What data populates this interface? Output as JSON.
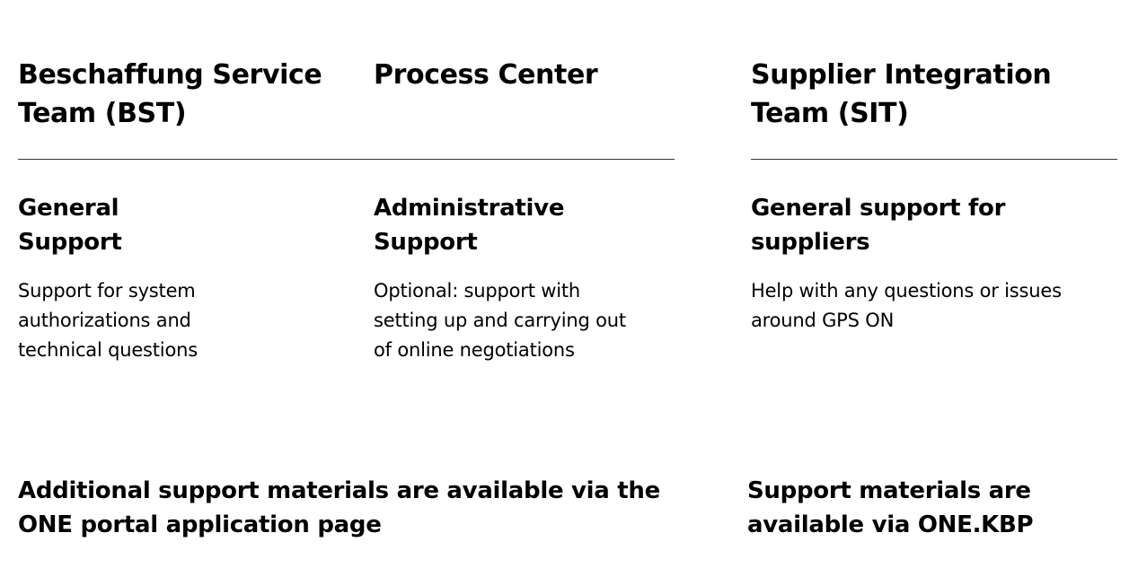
{
  "columns": [
    {
      "team_title": [
        "Beschaffung Service",
        "Team (BST)"
      ],
      "support_title": [
        "General",
        "Support"
      ],
      "support_description": [
        "Support for system",
        "authorizations and",
        "technical questions"
      ]
    },
    {
      "team_title": [
        "Process Center"
      ],
      "support_title": [
        "Administrative",
        "Support"
      ],
      "support_description": [
        "Optional: support with",
        "setting up and carrying out",
        "of online negotiations"
      ]
    },
    {
      "team_title": [
        "Supplier Integration",
        "Team (SIT)"
      ],
      "support_title": [
        "General support for",
        "suppliers"
      ],
      "support_description": [
        "Help with any questions or issues",
        "around GPS ON"
      ]
    }
  ],
  "footer": {
    "left_note": [
      "Additional support materials are available via the",
      "ONE portal application page"
    ],
    "right_note": [
      "Support materials are",
      "available via ONE.KBP"
    ]
  },
  "colors": {
    "text": "#000000",
    "divider": "#333333",
    "background": "#ffffff"
  }
}
